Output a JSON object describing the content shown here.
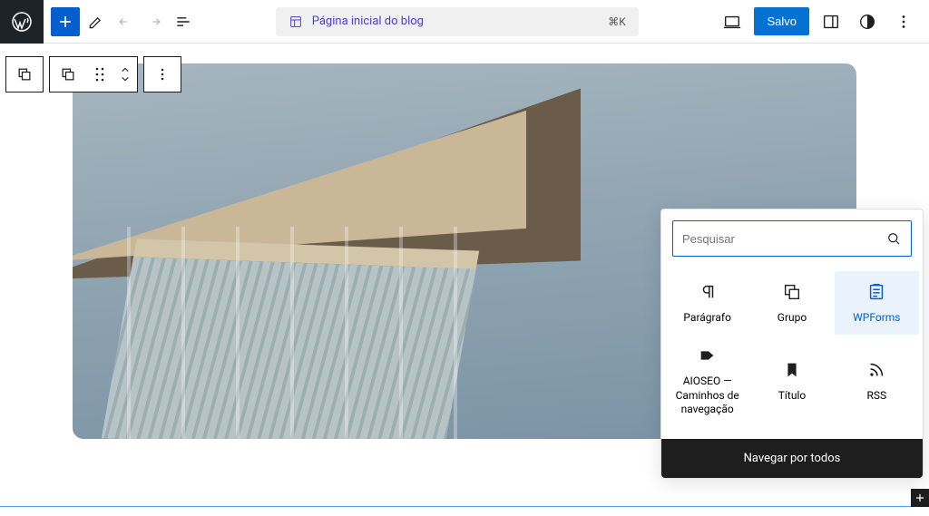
{
  "topbar": {
    "doc_title": "Página inicial do blog",
    "shortcut": "⌘K",
    "save_label": "Salvo"
  },
  "inserter": {
    "search_placeholder": "Pesquisar",
    "browse_all": "Navegar por todos",
    "items": [
      {
        "label": "Parágrafo"
      },
      {
        "label": "Grupo"
      },
      {
        "label": "WPForms"
      },
      {
        "label": "AIOSEO — Caminhos de navegação"
      },
      {
        "label": "Título"
      },
      {
        "label": "RSS"
      }
    ]
  }
}
